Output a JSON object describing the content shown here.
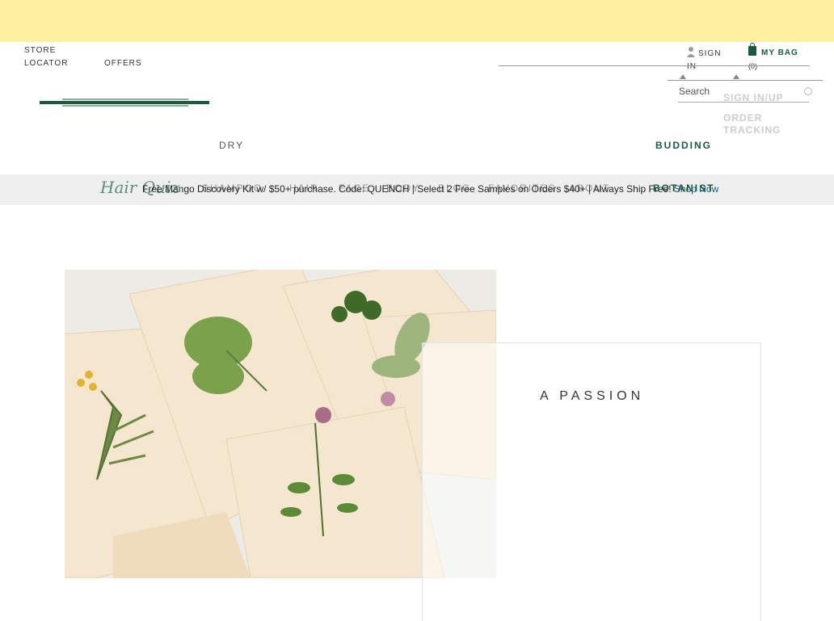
{
  "header": {
    "store_locator": "STORE LOCATOR",
    "offers": "OFFERS",
    "sign_in": "SIGN IN",
    "my_bag": "MY BAG",
    "bag_count": "(0)",
    "search_placeholder": "Search",
    "dropdown": [
      "SIGN IN/UP",
      "ORDER TRACKING"
    ]
  },
  "nav": {
    "dry": "DRY",
    "budding": "BUDDING",
    "hair_quiz": "Hair Quiz",
    "menu": [
      "SHAMPOO",
      "HAIR",
      "FACE",
      "BODY",
      "BLOG",
      "FAVORITES",
      "ABOUT"
    ],
    "botanist": "BOTANIST"
  },
  "promo": {
    "text": "Free Mango Discovery Kit w/ $50+ purchase. Code: QUENCH | Select 2 Free Samples on Orders $40+ | Always Ship Free!",
    "link": "Shop Now"
  },
  "hero": {
    "heading": "A PASSION"
  },
  "colors": {
    "topbar": "#fdf0a0",
    "brand_green": "#1a5a3c",
    "promo_bg": "#efefef"
  }
}
